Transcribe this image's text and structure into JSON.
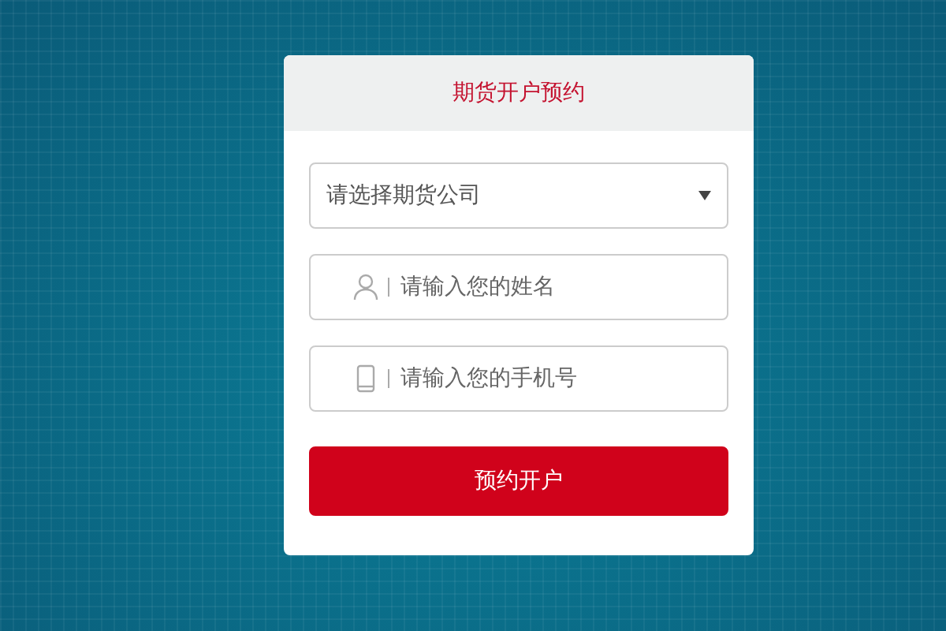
{
  "card": {
    "title": "期货开户预约"
  },
  "fields": [
    {
      "kind": "select",
      "value": "请选择期货公司"
    },
    {
      "kind": "name",
      "placeholder": "请输入您的姓名"
    },
    {
      "kind": "phone",
      "placeholder": "请输入您的手机号"
    }
  ],
  "submit_button": {
    "label": "预约开户"
  }
}
